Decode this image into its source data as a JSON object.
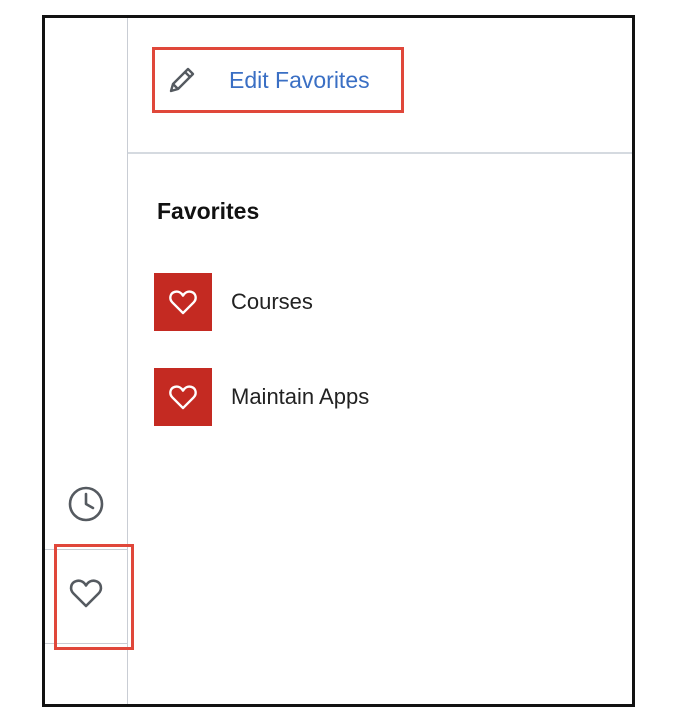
{
  "header": {
    "edit_favorites_label": "Edit Favorites",
    "edit_icon": "pencil-icon"
  },
  "favorites": {
    "title": "Favorites",
    "items": [
      {
        "label": "Courses",
        "icon": "heart-icon"
      },
      {
        "label": "Maintain Apps",
        "icon": "heart-icon"
      }
    ]
  },
  "rail": {
    "items": [
      {
        "icon": "clock-icon"
      },
      {
        "icon": "heart-icon"
      }
    ]
  },
  "colors": {
    "link": "#3a6fc4",
    "favorite_tile": "#c42a22",
    "highlight": "#e0473a"
  }
}
